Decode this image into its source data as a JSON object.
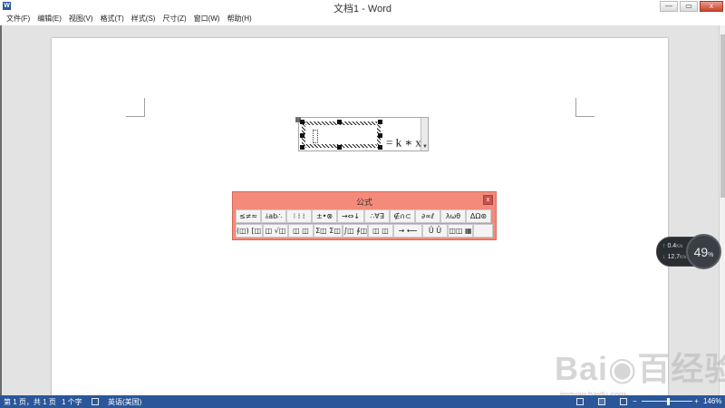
{
  "window": {
    "title": "文档1 - Word",
    "app_icon": "W",
    "buttons": {
      "minimize": "—",
      "restore": "▭",
      "close": "x"
    }
  },
  "menu": {
    "items": [
      "文件(F)",
      "编辑(E)",
      "视图(V)",
      "格式(T)",
      "样式(S)",
      "尺寸(Z)",
      "窗口(W)",
      "帮助(H)"
    ]
  },
  "equation": {
    "text": "= k ∗ x",
    "superscript": "'"
  },
  "equation_toolbar": {
    "title": "公式",
    "close_label": "x",
    "row1": [
      "≤≠≈",
      "⫰ab∴",
      "⁝ ⁞ ⁞",
      "±•⊗",
      "→⇔↓",
      "∴∀∃",
      "∉∩⊂",
      "∂∞ℓ",
      "λωθ",
      "ΔΩ⊛"
    ],
    "row2": [
      "(◫) [◫]",
      "◫ √◫",
      "◫ ◫",
      "Σ◫ Σ◫",
      "∫◫ ∮◫",
      "◫ ◫",
      "→ ⟵",
      "Ũ Ū",
      "◫◫ ▦"
    ]
  },
  "network_widget": {
    "up": "0.4",
    "down": "12.7",
    "unit": "K/s",
    "percent": "49",
    "percent_sign": "%"
  },
  "watermark": {
    "logo": "Bai◉百经验",
    "url": "jingyan.baidu.com"
  },
  "statusbar": {
    "page": "第 1 页，共 1 页",
    "words": "1 个字",
    "language": "英语(美国)",
    "zoom_minus": "−",
    "zoom_plus": "+",
    "zoom": "146%"
  },
  "colors": {
    "statusbar": "#2b579a",
    "toolbar": "#f48b7a",
    "workspace": "#e3e3e3"
  }
}
